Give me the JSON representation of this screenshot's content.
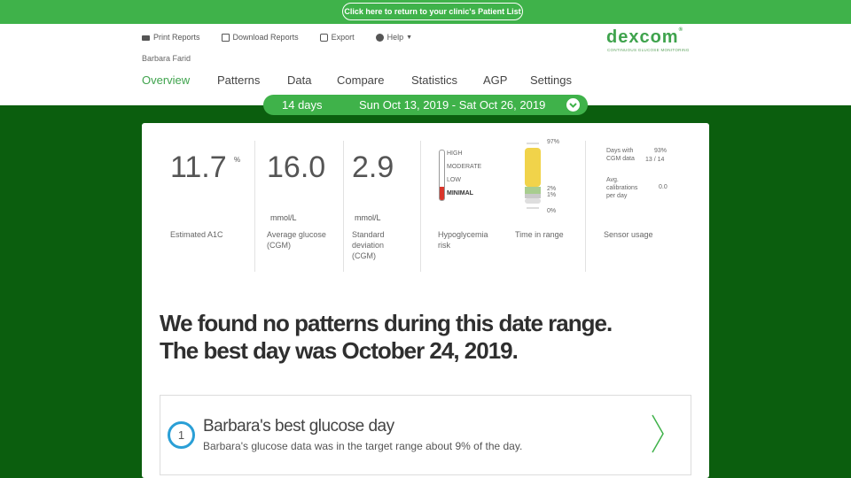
{
  "banner": {
    "return_label": "Click here to return to your clinic's Patient List"
  },
  "toolbar": {
    "print": "Print Reports",
    "download": "Download Reports",
    "export": "Export",
    "help": "Help"
  },
  "patient": {
    "name": "Barbara Farid"
  },
  "brand": {
    "logo": "DEXCOM",
    "tagline": "CONTINUOUS GLUCOSE MONITORING",
    "color": "#3fa34d"
  },
  "nav": {
    "items": [
      "Overview",
      "Patterns",
      "Data",
      "Compare",
      "Statistics",
      "AGP",
      "Settings"
    ],
    "active": "Overview"
  },
  "date_selector": {
    "days": "14 days",
    "range": "Sun Oct 13, 2019 - Sat Oct 26, 2019"
  },
  "metrics": {
    "a1c": {
      "value": "11.7",
      "sup": "%",
      "label": "Estimated A1C"
    },
    "avg_glucose": {
      "value": "16.0",
      "unit": "mmol/L",
      "label": "Average glucose (CGM)"
    },
    "std_dev": {
      "value": "2.9",
      "unit": "mmol/L",
      "label": "Standard deviation (CGM)"
    },
    "hypo_risk": {
      "levels": [
        "HIGH",
        "MODERATE",
        "LOW",
        "MINIMAL"
      ],
      "current": "MINIMAL",
      "label": "Hypoglycemia risk",
      "color": "#d9352a"
    },
    "time_in_range": {
      "high_pct": "97%",
      "in_range_pct": "2%",
      "low_pct": "1%",
      "very_low_pct": "0%",
      "label": "Time in range",
      "high_fraction": 0.97,
      "in_range_fraction": 0.02
    },
    "sensor_usage": {
      "days_label": "Days with CGM data",
      "days_pct": "93%",
      "days_count": "13 / 14",
      "cal_label": "Avg. calibrations per day",
      "cal_value": "0.0",
      "label": "Sensor usage"
    }
  },
  "headline": {
    "line1": "We found no patterns during this date range.",
    "line2": "The best day was October 24, 2019."
  },
  "best_day": {
    "number": "1",
    "title": "Barbara's best glucose day",
    "description": "Barbara's glucose data was in the target range about 9% of the day."
  }
}
